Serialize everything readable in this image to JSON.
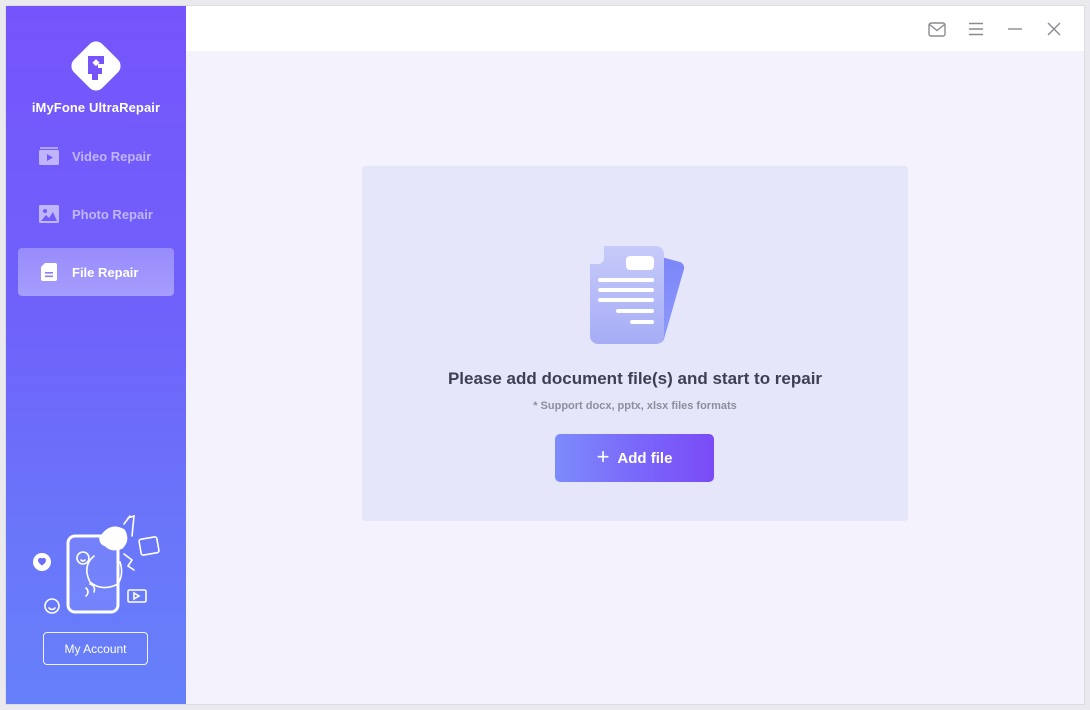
{
  "app": {
    "brand_name": "iMyFone UltraRepair",
    "logo_icon": "ultrarepair-logo"
  },
  "sidebar": {
    "items": [
      {
        "label": "Video Repair",
        "icon": "video-icon",
        "active": false
      },
      {
        "label": "Photo Repair",
        "icon": "photo-icon",
        "active": false
      },
      {
        "label": "File Repair",
        "icon": "file-icon",
        "active": true
      }
    ],
    "illustration": "person-repairing-illustration",
    "account_button": "My Account"
  },
  "titlebar": {
    "buttons": [
      {
        "name": "mail",
        "icon": "mail-icon"
      },
      {
        "name": "menu",
        "icon": "menu-icon"
      },
      {
        "name": "minimize",
        "icon": "minimize-icon"
      },
      {
        "name": "close",
        "icon": "close-icon"
      }
    ]
  },
  "main": {
    "dropzone": {
      "icon": "document-icon",
      "headline": "Please add document file(s) and start to repair",
      "subline": "* Support docx, pptx, xlsx files formats",
      "add_button": {
        "plus": "+",
        "label": "Add file"
      }
    }
  },
  "colors": {
    "sidebar_top": "#7654fb",
    "sidebar_bottom": "#6680fa",
    "main_bg": "#f4f3fd",
    "dropzone_bg": "#e6e6fb",
    "headline": "#3e3f55",
    "subline": "#8d8e9c",
    "button_start": "#7c8bfb",
    "button_end": "#7a4cf7"
  }
}
